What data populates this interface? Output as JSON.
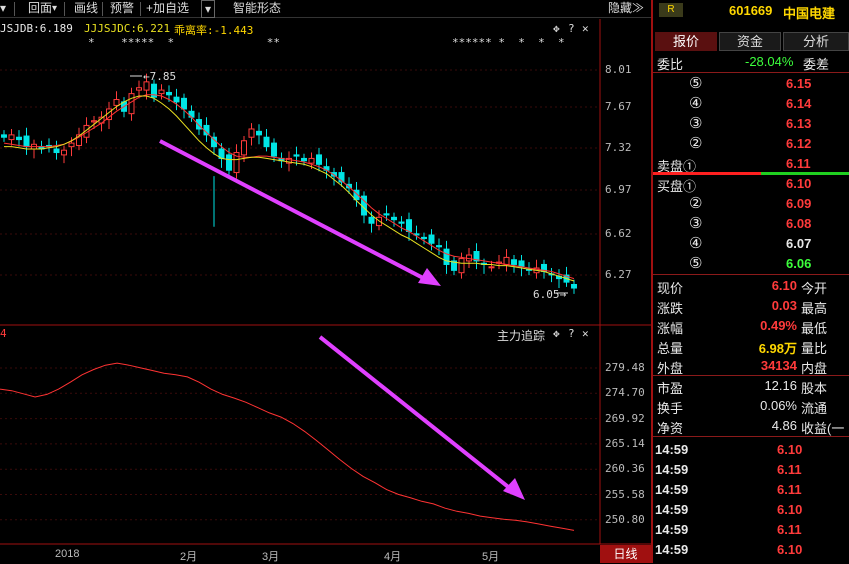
{
  "toolbar": {
    "menu_label": "回面",
    "items": [
      "画线",
      "预警"
    ],
    "add_label": "加自选",
    "smart_label": "智能形态",
    "hide_label": "隐藏"
  },
  "indicator_top": {
    "a": "JSJDB:6.189",
    "b": "JJJSJDC:6.221",
    "c": "乖离率:-1.443",
    "high_label": "7.85",
    "low_label": "6.05"
  },
  "indicator_bottom": {
    "prefix": "4",
    "name": "主力追踪"
  },
  "y_axis_top": [
    "8.01",
    "7.67",
    "7.32",
    "6.97",
    "6.62",
    "6.27"
  ],
  "y_axis_bottom": [
    "279.48",
    "274.70",
    "269.92",
    "265.14",
    "260.36",
    "255.58",
    "250.80"
  ],
  "x_axis": [
    "2018",
    "2月",
    "3月",
    "4月",
    "5月"
  ],
  "period_label": "日线",
  "stock": {
    "badge": "R",
    "code": "601669",
    "name": "中国电建"
  },
  "tabs": [
    "报价",
    "资金",
    "分析"
  ],
  "webi": {
    "label": "委比",
    "value": "-28.04%",
    "label2": "委差"
  },
  "sell": [
    {
      "n": "⑤",
      "price": "6.15"
    },
    {
      "n": "④",
      "price": "6.14"
    },
    {
      "n": "③",
      "price": "6.13"
    },
    {
      "n": "②",
      "price": "6.12"
    },
    {
      "label": "卖盘①",
      "price": "6.11"
    }
  ],
  "buy": [
    {
      "label": "买盘①",
      "price": "6.10"
    },
    {
      "n": "②",
      "price": "6.09"
    },
    {
      "n": "③",
      "price": "6.08"
    },
    {
      "n": "④",
      "price": "6.07"
    },
    {
      "n": "⑤",
      "price": "6.06"
    }
  ],
  "quote": [
    {
      "l1": "现价",
      "v": "6.10",
      "l2": "今开"
    },
    {
      "l1": "涨跌",
      "v": "0.03",
      "l2": "最高"
    },
    {
      "l1": "涨幅",
      "v": "0.49%",
      "l2": "最低"
    },
    {
      "l1": "总量",
      "v": "6.98万",
      "l2": "量比"
    },
    {
      "l1": "外盘",
      "v": "34134",
      "l2": "内盘"
    }
  ],
  "fund": [
    {
      "l1": "市盈",
      "v": "12.16",
      "l2": "股本"
    },
    {
      "l1": "换手",
      "v": "0.06%",
      "l2": "流通"
    },
    {
      "l1": "净资",
      "v": "4.86",
      "l2": "收益(一"
    }
  ],
  "ticks": [
    {
      "t": "14:59",
      "p": "6.10"
    },
    {
      "t": "14:59",
      "p": "6.11"
    },
    {
      "t": "14:59",
      "p": "6.11"
    },
    {
      "t": "14:59",
      "p": "6.10"
    },
    {
      "t": "14:59",
      "p": "6.11"
    },
    {
      "t": "14:59",
      "p": "6.10"
    }
  ],
  "chart_data": {
    "type": "candlestick",
    "ylim": [
      6.05,
      8.01
    ],
    "closes": [
      7.38,
      7.4,
      7.36,
      7.3,
      7.32,
      7.28,
      7.3,
      7.25,
      7.27,
      7.33,
      7.4,
      7.48,
      7.52,
      7.55,
      7.62,
      7.7,
      7.6,
      7.75,
      7.8,
      7.85,
      7.72,
      7.78,
      7.74,
      7.68,
      7.62,
      7.55,
      7.45,
      7.4,
      7.3,
      7.2,
      7.1,
      7.25,
      7.35,
      7.45,
      7.4,
      7.3,
      7.22,
      7.18,
      7.2,
      7.22,
      7.18,
      7.2,
      7.15,
      7.1,
      7.05,
      7.0,
      6.95,
      6.85,
      6.72,
      6.65,
      6.7,
      6.72,
      6.68,
      6.65,
      6.58,
      6.55,
      6.52,
      6.48,
      6.45,
      6.3,
      6.25,
      6.35,
      6.38,
      6.33,
      6.3,
      6.28,
      6.32,
      6.36,
      6.3,
      6.28,
      6.25,
      6.27,
      6.24,
      6.22,
      6.18,
      6.15,
      6.1
    ],
    "ma_red": [
      7.33,
      7.32,
      7.31,
      7.3,
      7.3,
      7.3,
      7.3,
      7.31,
      7.32,
      7.35,
      7.38,
      7.42,
      7.46,
      7.5,
      7.55,
      7.6,
      7.64,
      7.68,
      7.72,
      7.74,
      7.74,
      7.73,
      7.7,
      7.66,
      7.61,
      7.55,
      7.48,
      7.42,
      7.36,
      7.3,
      7.25,
      7.22,
      7.21,
      7.21,
      7.22,
      7.22,
      7.21,
      7.2,
      7.19,
      7.18,
      7.17,
      7.15,
      7.13,
      7.1,
      7.06,
      7.01,
      6.96,
      6.9,
      6.84,
      6.78,
      6.73,
      6.69,
      6.65,
      6.61,
      6.58,
      6.54,
      6.5,
      6.46,
      6.42,
      6.39,
      6.37,
      6.36,
      6.35,
      6.34,
      6.33,
      6.32,
      6.31,
      6.3,
      6.29,
      6.28,
      6.27,
      6.26,
      6.25,
      6.24,
      6.22,
      6.2,
      6.18
    ],
    "ma_yellow": [
      7.3,
      7.3,
      7.29,
      7.28,
      7.28,
      7.28,
      7.29,
      7.3,
      7.32,
      7.35,
      7.39,
      7.44,
      7.49,
      7.54,
      7.59,
      7.64,
      7.68,
      7.71,
      7.73,
      7.73,
      7.71,
      7.67,
      7.62,
      7.56,
      7.49,
      7.42,
      7.35,
      7.29,
      7.24,
      7.2,
      7.19,
      7.19,
      7.2,
      7.21,
      7.21,
      7.2,
      7.19,
      7.18,
      7.17,
      7.16,
      7.15,
      7.13,
      7.1,
      7.07,
      7.02,
      6.97,
      6.91,
      6.84,
      6.78,
      6.72,
      6.67,
      6.63,
      6.59,
      6.55,
      6.52,
      6.48,
      6.44,
      6.4,
      6.36,
      6.33,
      6.32,
      6.31,
      6.31,
      6.31,
      6.3,
      6.3,
      6.29,
      6.29,
      6.28,
      6.27,
      6.26,
      6.25,
      6.24,
      6.22,
      6.2,
      6.18,
      6.16
    ],
    "tracker": [
      275.5,
      275.2,
      274.6,
      274.0,
      274.5,
      275.5,
      276.8,
      278.2,
      279.2,
      280.0,
      280.4,
      280.0,
      279.5,
      279.0,
      278.5,
      278.2,
      277.8,
      276.8,
      275.5,
      274.5,
      273.8,
      273.0,
      272.0,
      271.0,
      270.2,
      269.0,
      267.5,
      265.8,
      264.0,
      262.2,
      260.5,
      259.0,
      257.8,
      256.5,
      255.6,
      255.0,
      254.3,
      253.8,
      253.0,
      252.4,
      252.0,
      251.5,
      251.2,
      250.9,
      250.7,
      250.4,
      250.0,
      249.6,
      249.2,
      248.8
    ]
  },
  "colors": {
    "up": "#ff3b3b",
    "down": "#00e5e5",
    "ma_red": "#ff3333",
    "ma_yellow": "#e8e020",
    "tracker": "#ff3333",
    "arrow": "#e040ff"
  }
}
